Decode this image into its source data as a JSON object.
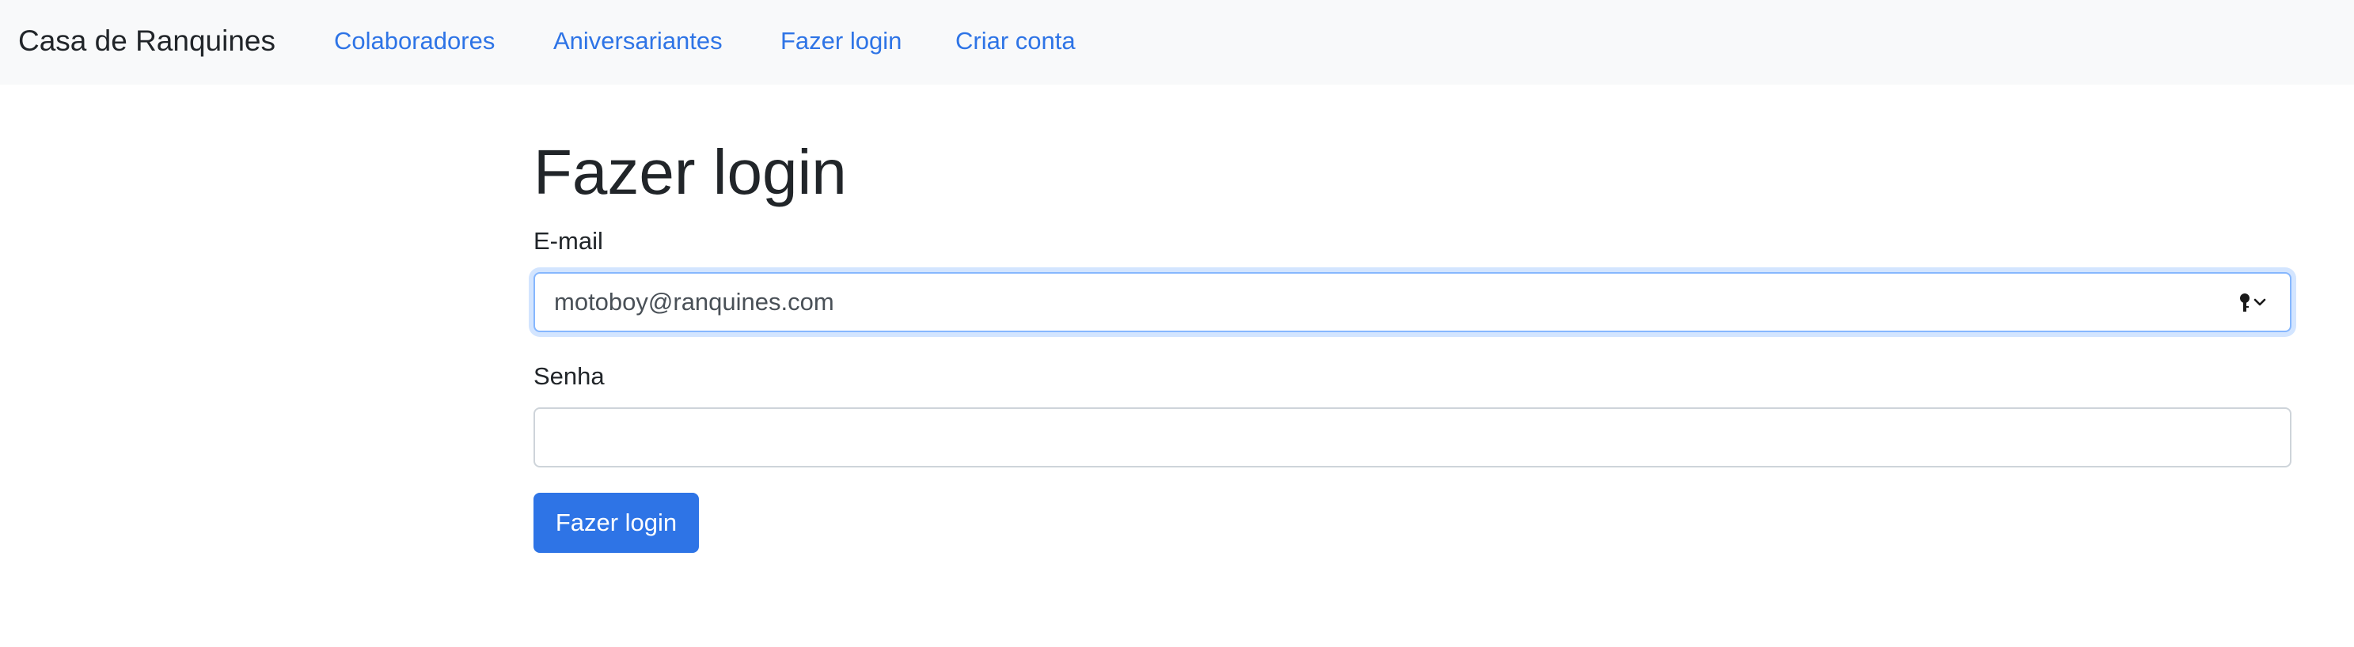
{
  "navbar": {
    "brand": "Casa de Ranquines",
    "links": [
      {
        "label": "Colaboradores"
      },
      {
        "label": "Aniversariantes"
      },
      {
        "label": "Fazer login"
      },
      {
        "label": "Criar conta"
      }
    ]
  },
  "main": {
    "title": "Fazer login",
    "email": {
      "label": "E-mail",
      "value": "motoboy@ranquines.com",
      "focused": true,
      "helper_icon": "key-icon"
    },
    "senha": {
      "label": "Senha",
      "value": ""
    },
    "submit_label": "Fazer login"
  },
  "colors": {
    "link": "#2e74e6",
    "button_bg": "#2e74e6",
    "navbar_bg": "#f8f9fa",
    "focus_border": "#86b7fe"
  }
}
